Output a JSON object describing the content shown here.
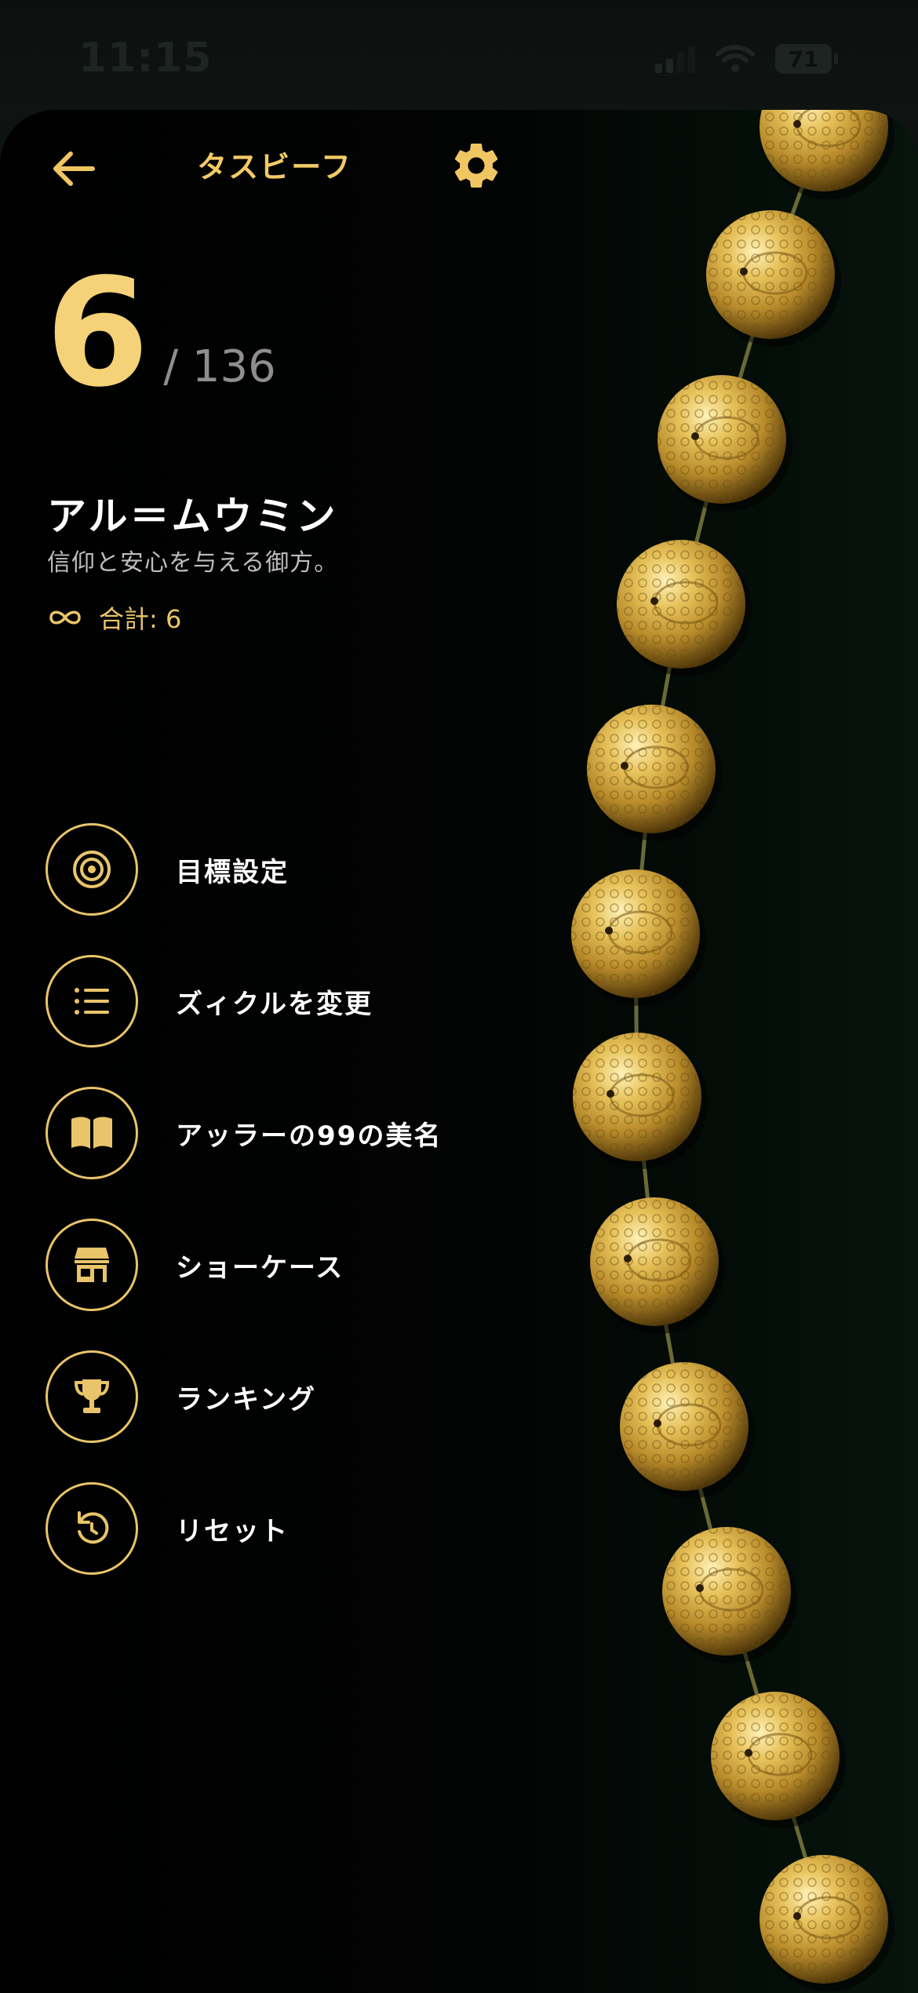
{
  "status_bar": {
    "time": "11:15",
    "battery": "71",
    "icons": [
      "signal-icon",
      "wifi-icon",
      "battery-icon"
    ]
  },
  "header": {
    "back_icon": "back-arrow-icon",
    "title": "タスビーフ",
    "settings_icon": "gear-icon"
  },
  "counter": {
    "current": "6",
    "target": "/ 136"
  },
  "dhikr": {
    "name": "アル＝ムウミン",
    "meaning": "信仰と安心を与える御方。",
    "total_label": "合計: 6",
    "total_icon": "infinity-icon"
  },
  "menu": [
    {
      "icon": "target-icon",
      "label": "目標設定"
    },
    {
      "icon": "list-icon",
      "label": "ズィクルを変更"
    },
    {
      "icon": "book-icon",
      "label": "アッラーの99の美名"
    },
    {
      "icon": "store-icon",
      "label": "ショーケース"
    },
    {
      "icon": "trophy-icon",
      "label": "ランキング"
    },
    {
      "icon": "reset-icon",
      "label": "リセット"
    }
  ],
  "colors": {
    "accent": "#e9c46a",
    "counter": "#f5d278",
    "background": "#000000",
    "bead_gold": "#c9a23a"
  },
  "beads": {
    "count": 12,
    "icon": "prayer-bead-icon"
  }
}
